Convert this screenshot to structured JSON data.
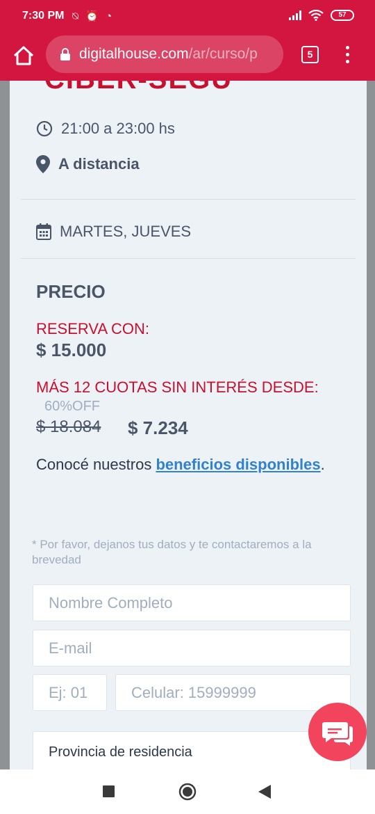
{
  "status_bar": {
    "time": "7:30 PM",
    "left_icons": "⍉ ⏰ ◔",
    "battery": "57"
  },
  "browser": {
    "url_domain": "digitalhouse.com",
    "url_path": "/ar/curso/p",
    "tab_count": "5"
  },
  "course": {
    "title_cut": "CIBER-SEGU",
    "schedule": "21:00 a 23:00 hs",
    "modality": "A distancia",
    "days": "MARTES, JUEVES"
  },
  "pricing": {
    "heading": "PRECIO",
    "reserve_label": "RESERVA CON:",
    "reserve_amount": "$ 15.000",
    "installments_label": "MÁS 12 CUOTAS SIN INTERÉS DESDE:",
    "discount": "60%OFF",
    "old_price": "$ 18.084",
    "new_price": "$ 7.234"
  },
  "benefits": {
    "text_before": "Conocé nuestros ",
    "link": "beneficios disponibles",
    "text_after": "."
  },
  "form": {
    "note": "* Por favor, dejanos tus datos y te contactaremos a la brevedad",
    "name_placeholder": "Nombre Completo",
    "email_placeholder": "E-mail",
    "area_placeholder": "Ej: 01",
    "phone_placeholder": "Celular: 15999999",
    "province_label": "Provincia de residencia"
  },
  "colors": {
    "brand_red": "#d3163f",
    "chat_button": "#f2445c",
    "link_blue": "#3182ce"
  }
}
